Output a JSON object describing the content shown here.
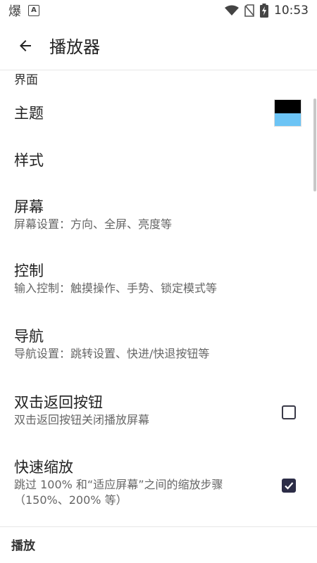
{
  "status_bar": {
    "time": "10:53",
    "left_glyph": "爆",
    "left_box": "A",
    "icons": [
      "wifi-icon",
      "no-sim-icon",
      "battery-charging-icon"
    ]
  },
  "app_bar": {
    "title": "播放器",
    "back_icon": "arrow-left-icon"
  },
  "sections": {
    "interface": "界面",
    "playback": "播放"
  },
  "items": [
    {
      "title": "主题",
      "summary": "",
      "widget": "color-swatch",
      "swatch_colors": [
        "#000000",
        "#6cc4f5"
      ]
    },
    {
      "title": "样式",
      "summary": ""
    },
    {
      "title": "屏幕",
      "summary": "屏幕设置：方向、全屏、亮度等"
    },
    {
      "title": "控制",
      "summary": "输入控制：触摸操作、手势、锁定模式等"
    },
    {
      "title": "导航",
      "summary": "导航设置：跳转设置、快进/快退按钮等"
    },
    {
      "title": "双击返回按钮",
      "summary": "双击返回按钮关闭播放屏幕",
      "checked": false
    },
    {
      "title": "快速缩放",
      "summary": "跳过 100% 和“适应屏幕”之间的缩放步骤（150%、200% 等）",
      "checked": true
    }
  ],
  "colors": {
    "checkbox_checked": "#2c2d47",
    "accent_swatch": "#6cc4f5"
  }
}
